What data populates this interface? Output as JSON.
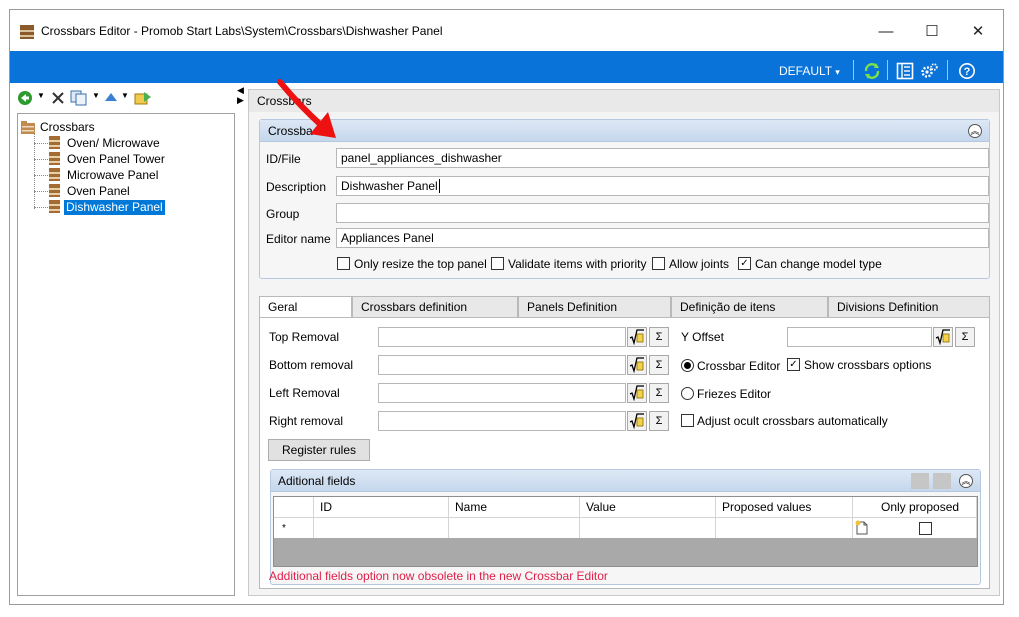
{
  "window": {
    "title": "Crossbars Editor - Promob Start Labs\\System\\Crossbars\\Dishwasher Panel",
    "minimize": "—",
    "maximize": "☐",
    "close": "✕"
  },
  "toolbar": {
    "profile": "DEFAULT",
    "profile_arrow": "▾",
    "icons": [
      "refresh-icon",
      "panel-layout-icon",
      "settings-icon",
      "help-icon"
    ]
  },
  "tree_toolbar": {
    "icons": [
      "back-icon",
      "dropdown-icon",
      "delete-icon",
      "copy-icon",
      "dropdown-icon",
      "move-up-icon",
      "dropdown-icon",
      "export-icon"
    ]
  },
  "tree": {
    "root": "Crossbars",
    "items": [
      {
        "label": "Oven/ Microwave",
        "selected": false
      },
      {
        "label": "Oven Panel Tower",
        "selected": false
      },
      {
        "label": "Microwave Panel",
        "selected": false
      },
      {
        "label": "Oven Panel",
        "selected": false
      },
      {
        "label": "Dishwasher Panel",
        "selected": true
      }
    ]
  },
  "breadcrumb": "Crossbars",
  "crossbar_group": {
    "title": "Crossba",
    "labels": {
      "id_file": "ID/File",
      "description": "Description",
      "group": "Group",
      "editor_name": "Editor name"
    },
    "values": {
      "id_file": "panel_appliances_dishwasher",
      "description": "Dishwasher Panel",
      "group": "",
      "editor_name": "Appliances Panel"
    },
    "options": [
      {
        "label": "Only resize the top panel",
        "checked": false
      },
      {
        "label": "Validate items with priority",
        "checked": false
      },
      {
        "label": "Allow joints",
        "checked": false
      },
      {
        "label": "Can change model type",
        "checked": true
      }
    ]
  },
  "tabs": [
    {
      "label": "Geral",
      "active": true
    },
    {
      "label": "Crossbars definition",
      "active": false
    },
    {
      "label": "Panels Definition",
      "active": false
    },
    {
      "label": "Definição de itens",
      "active": false
    },
    {
      "label": "Divisions Definition",
      "active": false
    }
  ],
  "geral": {
    "fields": [
      {
        "label": "Top Removal",
        "value": ""
      },
      {
        "label": "Bottom removal",
        "value": ""
      },
      {
        "label": "Left Removal",
        "value": ""
      },
      {
        "label": "Right removal",
        "value": ""
      }
    ],
    "y_offset_label": "Y Offset",
    "y_offset_value": "",
    "editor_mode": [
      {
        "label": "Crossbar Editor",
        "selected": true
      },
      {
        "label": "Friezes Editor",
        "selected": false
      }
    ],
    "show_crossbars_options": {
      "label": "Show crossbars options",
      "checked": true
    },
    "adjust_ocult": {
      "label": "Adjust ocult crossbars automatically",
      "checked": false
    },
    "register_rules": "Register rules",
    "sigma": "Σ"
  },
  "additional_fields": {
    "title": "Aditional fields",
    "columns": [
      "ID",
      "Name",
      "Value",
      "Proposed values",
      "Only proposed"
    ],
    "new_row_marker": "*",
    "new_row_only_proposed": false
  },
  "warning": "Additional fields option now obsolete in the new Crossbar Editor",
  "colors": {
    "accent": "#0a73d9",
    "selection": "#0078d7",
    "warning": "#e0204a",
    "annotation_arrow": "#ee1111"
  }
}
